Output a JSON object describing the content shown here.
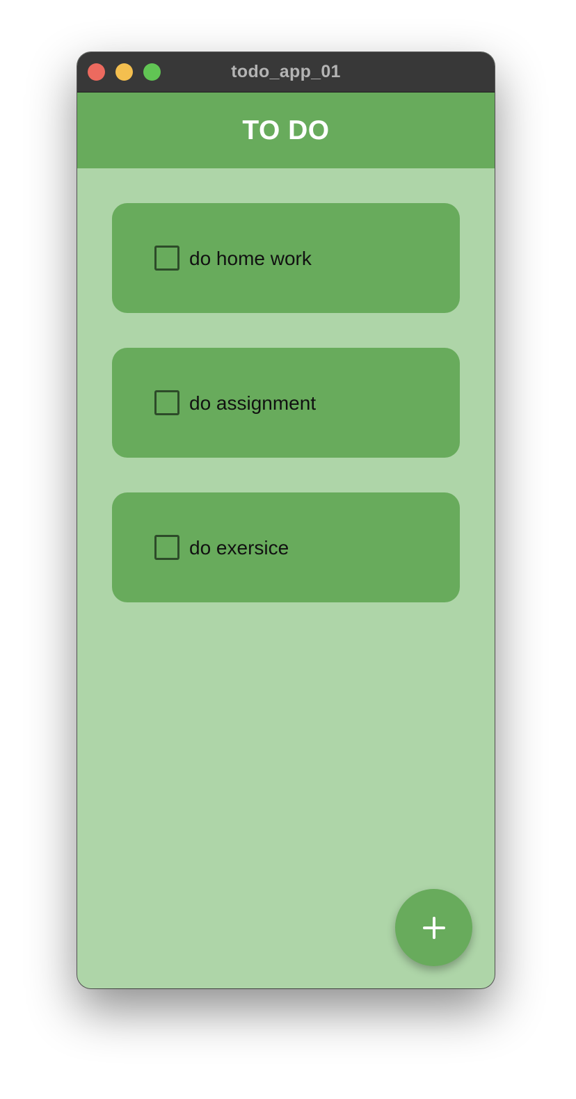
{
  "window": {
    "title": "todo_app_01"
  },
  "appbar": {
    "title": "TO DO"
  },
  "todos": [
    {
      "label": "do home work",
      "checked": false
    },
    {
      "label": "do assignment",
      "checked": false
    },
    {
      "label": "do exersice",
      "checked": false
    }
  ],
  "fab": {
    "icon": "plus-icon"
  },
  "colors": {
    "titlebar": "#383838",
    "appbar": "#68ab5c",
    "background": "#aed5a8",
    "card": "#68ab5c",
    "fab": "#68ab5c"
  }
}
